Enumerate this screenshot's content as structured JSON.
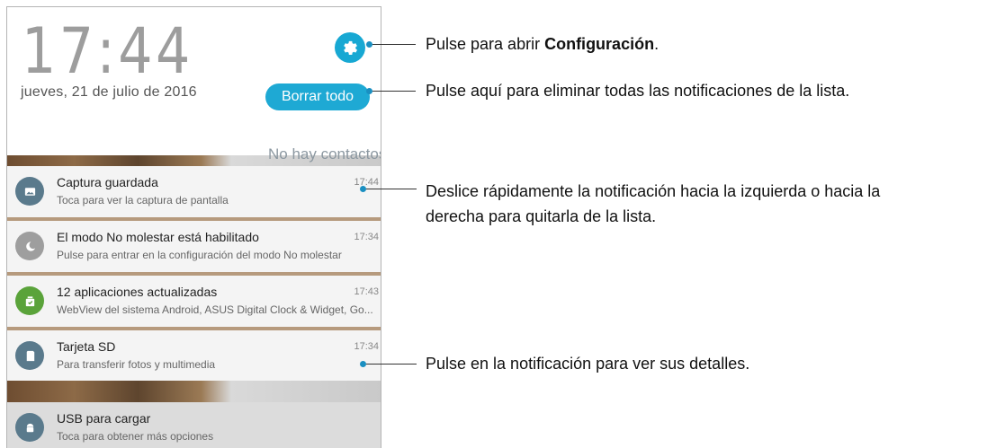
{
  "lock": {
    "time": "17:44",
    "date": "jueves, 21 de julio de 2016",
    "clear_all_label": "Borrar todo",
    "settings_icon": "gear-icon",
    "background_text": "No hay contactos en"
  },
  "notifications": [
    {
      "title": "Captura guardada",
      "subtitle": "Toca para ver la captura de pantalla",
      "time": "17:44",
      "icon": "image-icon",
      "icon_color": "#5a7a8c"
    },
    {
      "title": "El modo No molestar está habilitado",
      "subtitle": "Pulse para entrar en la configuración del modo No molestar",
      "time": "17:34",
      "icon": "moon-icon",
      "icon_color": "#9e9e9e"
    },
    {
      "title": "12 aplicaciones actualizadas",
      "subtitle": "WebView del sistema Android, ASUS Digital Clock & Widget, Go...",
      "time": "17:43",
      "icon": "update-icon",
      "icon_color": "#5aa33a"
    },
    {
      "title": "Tarjeta SD",
      "subtitle": "Para transferir fotos y multimedia",
      "time": "17:34",
      "icon": "sd-card-icon",
      "icon_color": "#5a7a8c"
    },
    {
      "title": "USB para cargar",
      "subtitle": "Toca para obtener más opciones",
      "time": "",
      "icon": "android-icon",
      "icon_color": "#5a7a8c"
    }
  ],
  "annotations": {
    "settings_prefix": "Pulse para abrir ",
    "settings_bold": "Configuración",
    "settings_suffix": ".",
    "clear_all": "Pulse aquí para eliminar todas las notificaciones de la lista.",
    "swipe_line1": "Deslice rápidamente la notificación hacia la izquierda o hacia la",
    "swipe_line2": "derecha para quitarla de la lista.",
    "tap": "Pulse en la notificación para ver sus detalles."
  },
  "colors": {
    "accent": "#17a8d3",
    "annotation_dot": "#1a8fc1"
  }
}
